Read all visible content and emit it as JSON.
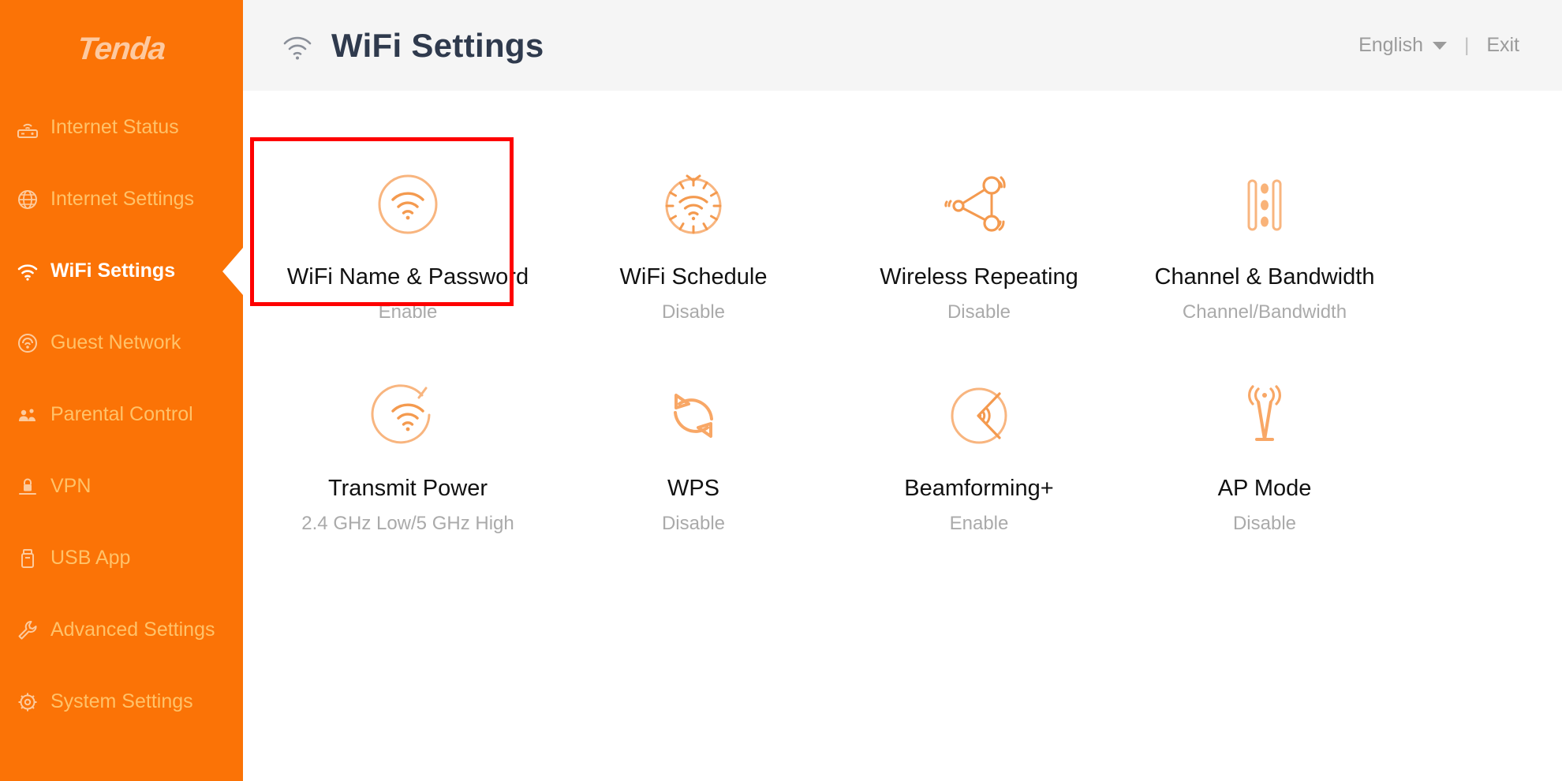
{
  "brand": {
    "name": "Tenda"
  },
  "sidebar": {
    "items": [
      {
        "label": "Internet Status",
        "icon": "router-icon",
        "active": false
      },
      {
        "label": "Internet Settings",
        "icon": "globe-icon",
        "active": false
      },
      {
        "label": "WiFi Settings",
        "icon": "wifi-icon",
        "active": true
      },
      {
        "label": "Guest Network",
        "icon": "guest-network-icon",
        "active": false
      },
      {
        "label": "Parental Control",
        "icon": "parental-control-icon",
        "active": false
      },
      {
        "label": "VPN",
        "icon": "vpn-lock-icon",
        "active": false
      },
      {
        "label": "USB App",
        "icon": "usb-icon",
        "active": false
      },
      {
        "label": "Advanced Settings",
        "icon": "wrench-icon",
        "active": false
      },
      {
        "label": "System Settings",
        "icon": "gear-icon",
        "active": false
      }
    ]
  },
  "header": {
    "title": "WiFi Settings",
    "title_icon": "wifi-icon",
    "language": "English",
    "language_caret": "chevron-down-icon",
    "separator": "|",
    "exit": "Exit"
  },
  "main": {
    "tiles": [
      {
        "label": "WiFi Name & Password",
        "status": "Enable",
        "icon": "wifi-circle-icon",
        "selected": true
      },
      {
        "label": "WiFi Schedule",
        "status": "Disable",
        "icon": "wifi-timer-icon",
        "selected": false
      },
      {
        "label": "Wireless Repeating",
        "status": "Disable",
        "icon": "repeater-nodes-icon",
        "selected": false
      },
      {
        "label": "Channel & Bandwidth",
        "status": "Channel/Bandwidth",
        "icon": "channel-bars-icon",
        "selected": false
      },
      {
        "label": "Transmit Power",
        "status": "2.4 GHz Low/5 GHz High",
        "icon": "transmit-power-icon",
        "selected": false
      },
      {
        "label": "WPS",
        "status": "Disable",
        "icon": "wps-refresh-icon",
        "selected": false
      },
      {
        "label": "Beamforming+",
        "status": "Enable",
        "icon": "beamforming-icon",
        "selected": false
      },
      {
        "label": "AP Mode",
        "status": "Disable",
        "icon": "antenna-tower-icon",
        "selected": false
      }
    ]
  },
  "colors": {
    "sidebar_orange": "#fb7306",
    "sidebar_label": "#ffc269",
    "active_label": "#ffffff",
    "header_bg": "#f5f5f5",
    "title_text": "#2f3a4d",
    "tile_icon": "#f7a869",
    "tile_label": "#111111",
    "tile_status": "#aaaaaa",
    "selection_border": "#fe0000"
  }
}
